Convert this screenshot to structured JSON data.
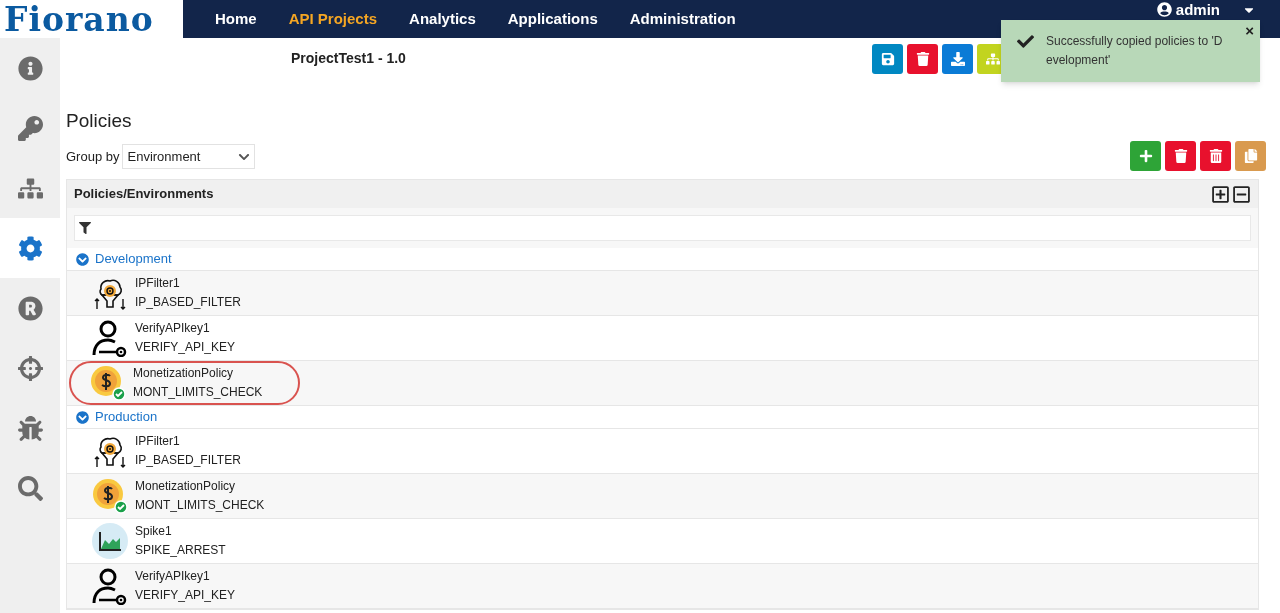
{
  "brand": {
    "logo": "Fiorano"
  },
  "nav": [
    {
      "label": "Home",
      "selected": false
    },
    {
      "label": "API Projects",
      "selected": true
    },
    {
      "label": "Analytics",
      "selected": false
    },
    {
      "label": "Applications",
      "selected": false
    },
    {
      "label": "Administration",
      "selected": false
    }
  ],
  "user": {
    "name": "admin"
  },
  "sidebar": {
    "items": [
      {
        "selected": false
      },
      {
        "selected": false
      },
      {
        "selected": false
      },
      {
        "selected": true
      },
      {
        "selected": false
      },
      {
        "selected": false
      },
      {
        "selected": false
      },
      {
        "selected": false
      }
    ]
  },
  "project": {
    "title": "ProjectTest1 - 1.0"
  },
  "toast": {
    "message": "Successfully copied policies to 'D evelopment'",
    "close": "×"
  },
  "policies": {
    "title": "Policies",
    "group_by": {
      "label": "Group by",
      "value": "Environment"
    },
    "panel_title": "Policies/Environments",
    "groups": [
      {
        "name": "Development",
        "expanded": true,
        "items": [
          {
            "kind": "ipfilter",
            "name": "IPFilter1",
            "type": "IP_BASED_FILTER",
            "highlighted": false
          },
          {
            "kind": "apikey",
            "name": "VerifyAPIkey1",
            "type": "VERIFY_API_KEY",
            "highlighted": false
          },
          {
            "kind": "monetization",
            "name": "MonetizationPolicy",
            "type": "MONT_LIMITS_CHECK",
            "highlighted": true
          }
        ]
      },
      {
        "name": "Production",
        "expanded": true,
        "items": [
          {
            "kind": "ipfilter",
            "name": "IPFilter1",
            "type": "IP_BASED_FILTER",
            "highlighted": false
          },
          {
            "kind": "monetization",
            "name": "MonetizationPolicy",
            "type": "MONT_LIMITS_CHECK",
            "highlighted": false
          },
          {
            "kind": "spike",
            "name": "Spike1",
            "type": "SPIKE_ARREST",
            "highlighted": false
          },
          {
            "kind": "apikey",
            "name": "VerifyAPIkey1",
            "type": "VERIFY_API_KEY",
            "highlighted": false
          }
        ]
      }
    ]
  }
}
